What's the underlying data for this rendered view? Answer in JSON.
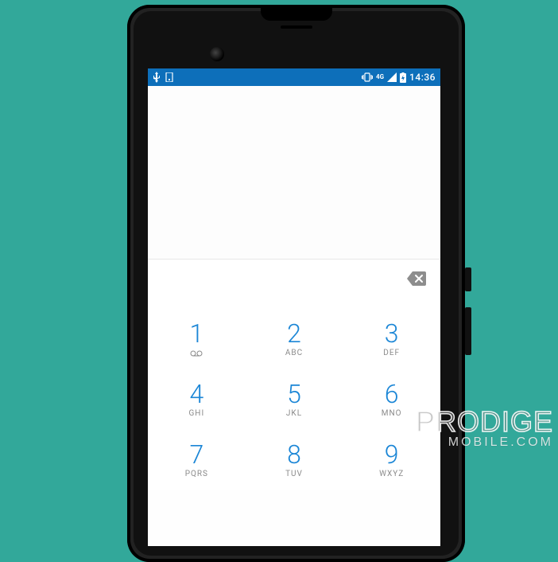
{
  "status": {
    "clock": "14:36",
    "network_label": "4G"
  },
  "dialpad": {
    "keys": [
      {
        "digit": "1",
        "sub": "voicemail"
      },
      {
        "digit": "2",
        "sub": "ABC"
      },
      {
        "digit": "3",
        "sub": "DEF"
      },
      {
        "digit": "4",
        "sub": "GHI"
      },
      {
        "digit": "5",
        "sub": "JKL"
      },
      {
        "digit": "6",
        "sub": "MNO"
      },
      {
        "digit": "7",
        "sub": "PQRS"
      },
      {
        "digit": "8",
        "sub": "TUV"
      },
      {
        "digit": "9",
        "sub": "WXYZ"
      }
    ]
  },
  "watermark": {
    "line1": "PRODIGE",
    "line2_a": "MOBILE",
    "line2_b": "COM"
  }
}
